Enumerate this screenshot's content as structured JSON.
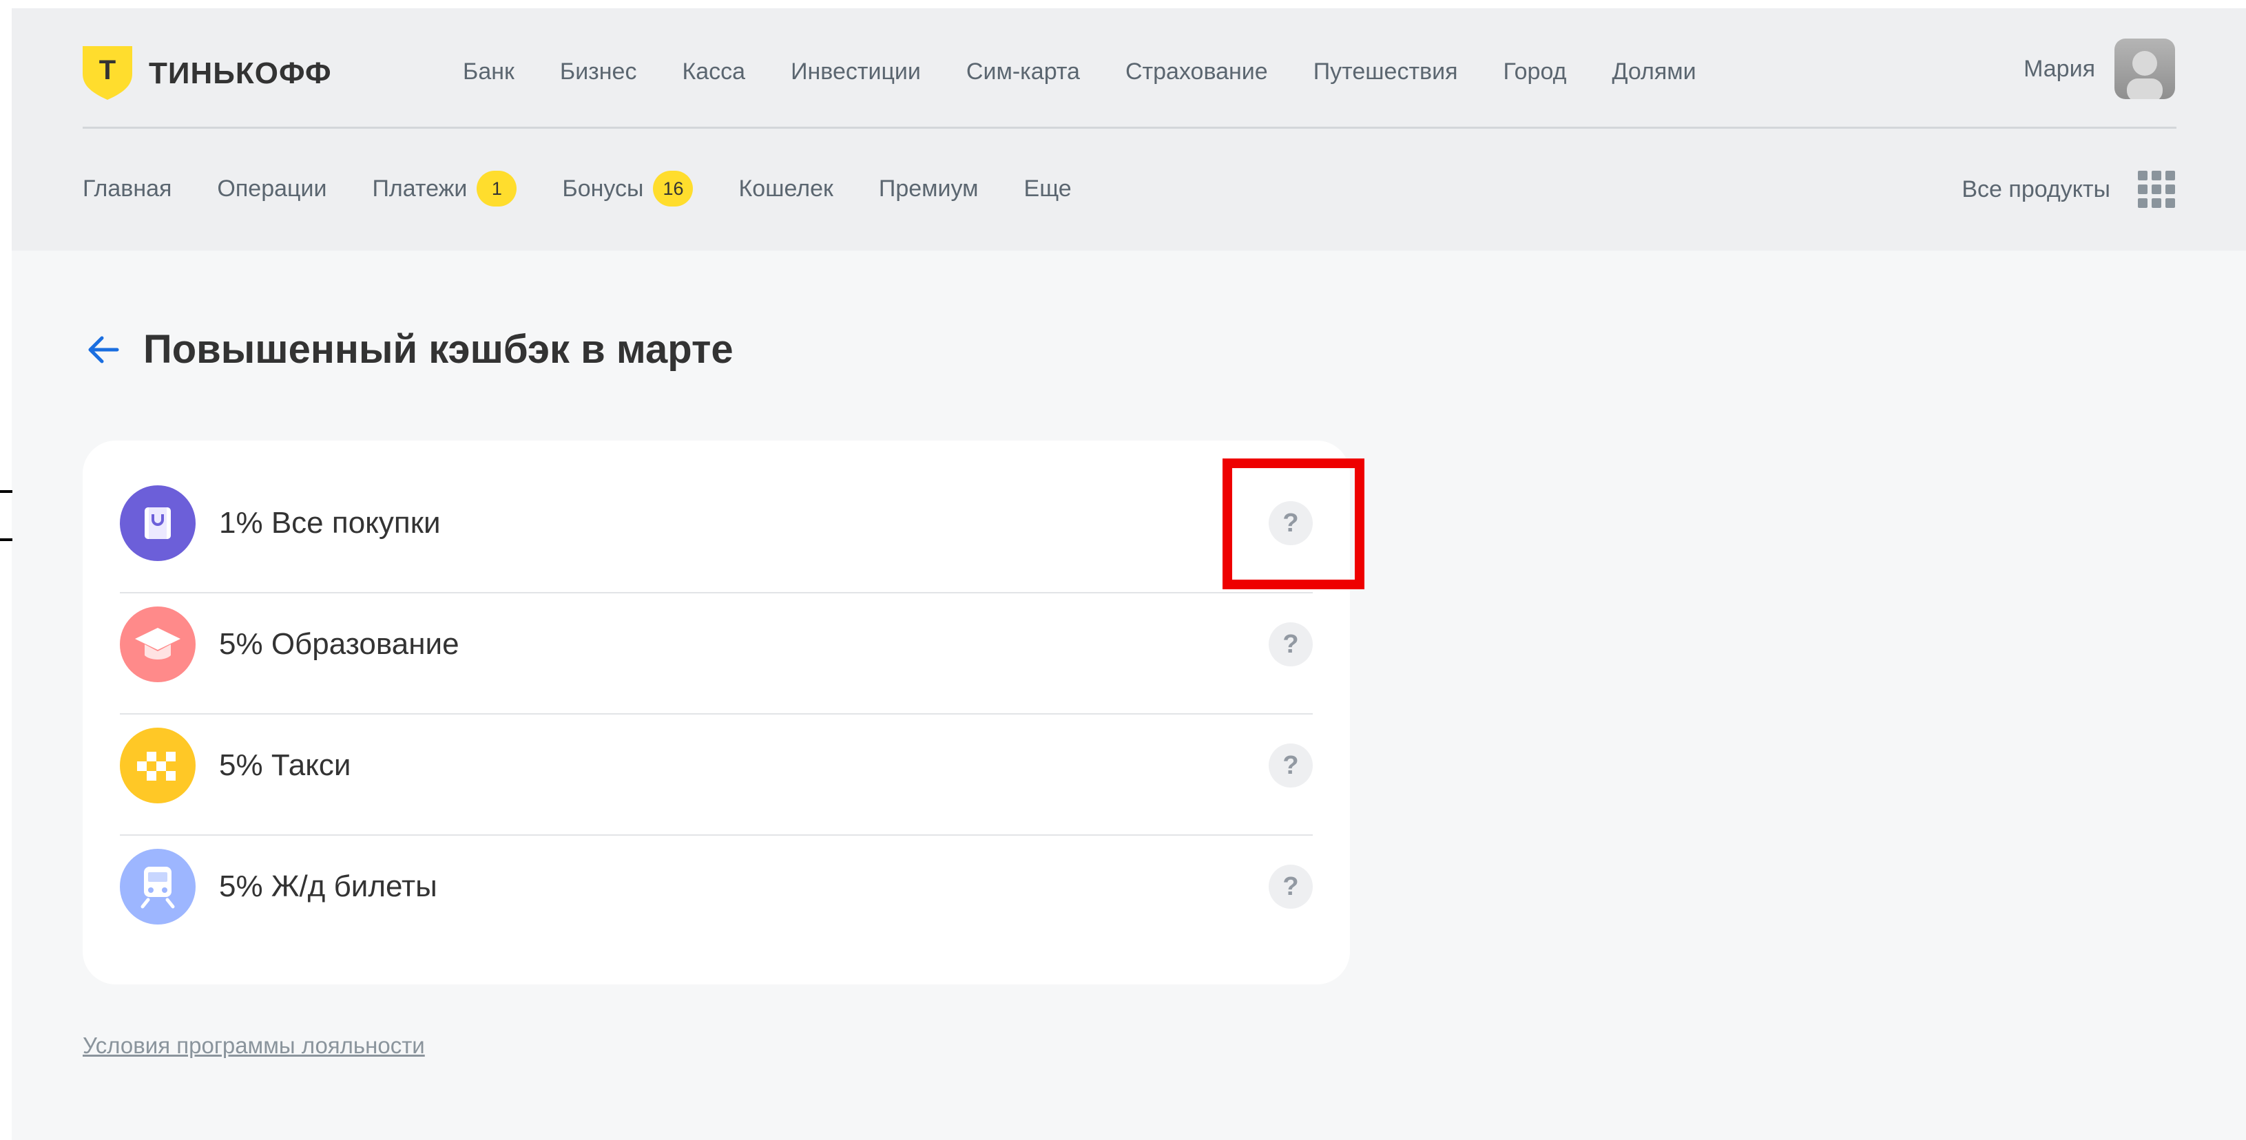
{
  "brand": {
    "name": "ТИНЬКОФФ",
    "letter": "Т",
    "accent_color": "#ffdd2d"
  },
  "top_nav": [
    "Банк",
    "Бизнес",
    "Касса",
    "Инвестиции",
    "Сим-карта",
    "Страхование",
    "Путешествия",
    "Город",
    "Долями"
  ],
  "user": {
    "name": "Мария"
  },
  "sub_nav": [
    {
      "label": "Главная"
    },
    {
      "label": "Операции"
    },
    {
      "label": "Платежи",
      "badge": "1"
    },
    {
      "label": "Бонусы",
      "badge": "16"
    },
    {
      "label": "Кошелек"
    },
    {
      "label": "Премиум"
    },
    {
      "label": "Еще"
    }
  ],
  "all_products_label": "Все продукты",
  "page_title": "Повышенный кэшбэк в марте",
  "cashback_items": [
    {
      "label": "1% Все покупки",
      "icon": "shopping-bag-icon",
      "color": "#6c5fd9",
      "help": "?"
    },
    {
      "label": "5% Образование",
      "icon": "graduation-cap-icon",
      "color": "#ff8a8a",
      "help": "?"
    },
    {
      "label": "5% Такси",
      "icon": "taxi-checker-icon",
      "color": "#ffc826",
      "help": "?"
    },
    {
      "label": "5% Ж/д билеты",
      "icon": "train-icon",
      "color": "#9db6ff",
      "help": "?"
    }
  ],
  "terms_link": "Условия программы лояльности",
  "highlight_color": "#ee0000"
}
